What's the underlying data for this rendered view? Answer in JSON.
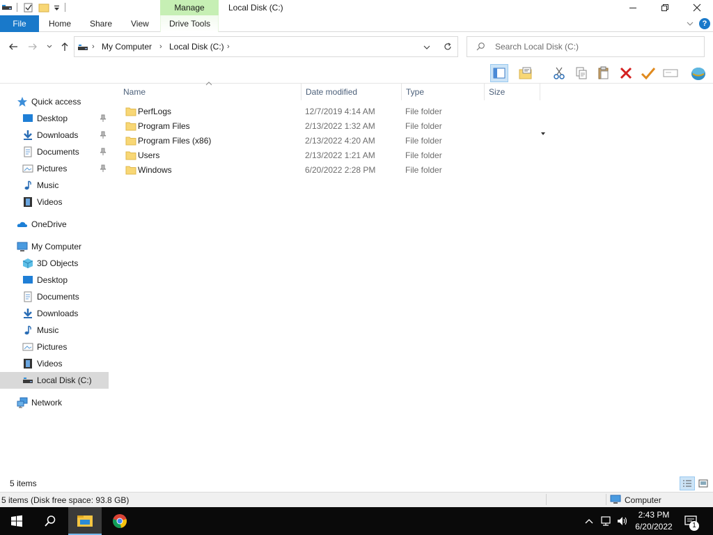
{
  "titlebar": {
    "manage_label": "Manage",
    "title": "Local Disk (C:)",
    "minimize_label": "—",
    "maximize_label": "❐",
    "close_label": "✕"
  },
  "ribbon": {
    "file": "File",
    "home": "Home",
    "share": "Share",
    "view": "View",
    "drive_tools": "Drive Tools",
    "help_label": "?"
  },
  "address": {
    "breadcrumbs": [
      "My Computer",
      "Local Disk (C:)"
    ],
    "search_placeholder": "Search Local Disk (C:)"
  },
  "sidebar": {
    "quick_access": "Quick access",
    "quick_items": [
      "Desktop",
      "Downloads",
      "Documents",
      "Pictures",
      "Music",
      "Videos"
    ],
    "onedrive": "OneDrive",
    "my_computer": "My Computer",
    "computer_items": [
      "3D Objects",
      "Desktop",
      "Documents",
      "Downloads",
      "Music",
      "Pictures",
      "Videos",
      "Local Disk (C:)"
    ],
    "network": "Network"
  },
  "columns": {
    "name": "Name",
    "date": "Date modified",
    "type": "Type",
    "size": "Size"
  },
  "files": [
    {
      "name": "PerfLogs",
      "date": "12/7/2019 4:14 AM",
      "type": "File folder"
    },
    {
      "name": "Program Files",
      "date": "2/13/2022 1:32 AM",
      "type": "File folder"
    },
    {
      "name": "Program Files (x86)",
      "date": "2/13/2022 4:20 AM",
      "type": "File folder"
    },
    {
      "name": "Users",
      "date": "2/13/2022 1:21 AM",
      "type": "File folder"
    },
    {
      "name": "Windows",
      "date": "6/20/2022 2:28 PM",
      "type": "File folder"
    }
  ],
  "status": {
    "item_count": "5 items",
    "disk_info": "5 items (Disk free space: 93.8 GB)",
    "location": "Computer"
  },
  "taskbar": {
    "time": "2:43 PM",
    "date": "6/20/2022",
    "notification_count": "1"
  },
  "colors": {
    "accent": "#1979ca",
    "manage_tab": "#c6efb4",
    "selected": "#d9d9d9",
    "folder": "#f8d775"
  }
}
